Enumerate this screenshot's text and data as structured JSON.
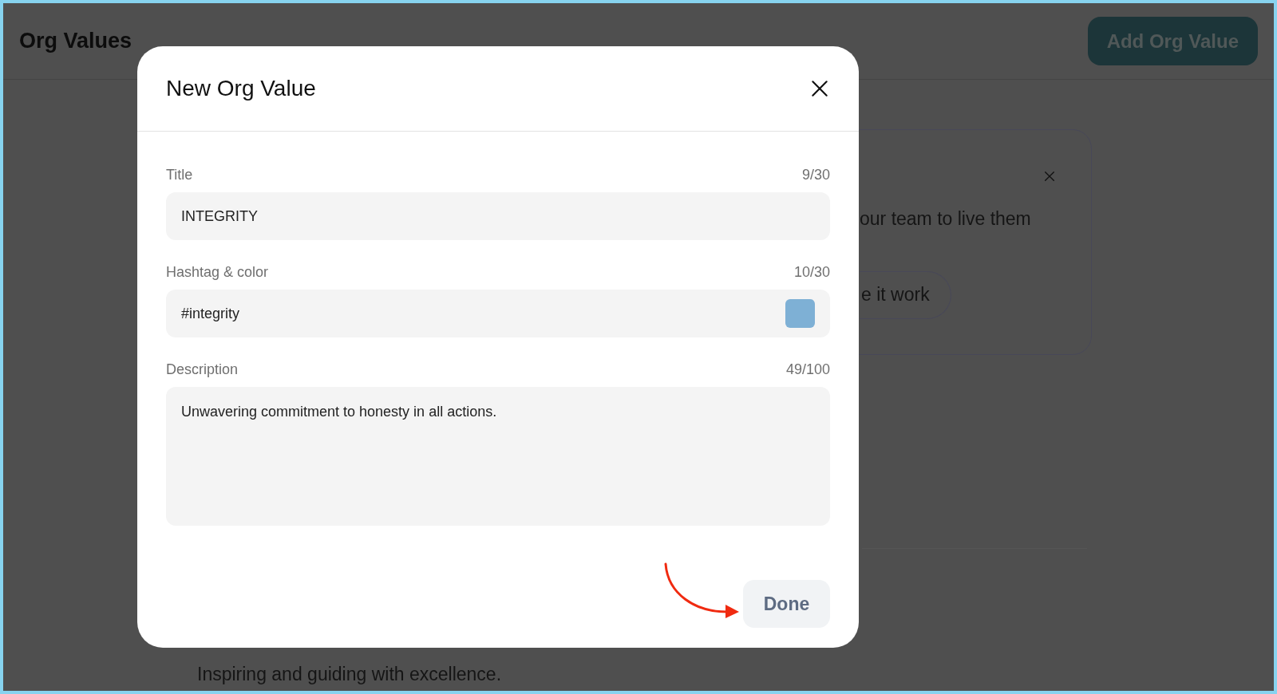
{
  "page": {
    "title": "Org Values",
    "add_button": "Add Org Value"
  },
  "background_card": {
    "text": "our team to live them",
    "button": "e it work"
  },
  "background_text": "Inspiring and guiding with excellence.",
  "dialog": {
    "title": "New Org Value",
    "fields": [
      {
        "kind": "text",
        "label": "Title",
        "count": "9/30",
        "value": "INTEGRITY"
      },
      {
        "kind": "color",
        "label": "Hashtag & color",
        "count": "10/30",
        "value": "#integrity",
        "color": "#7eb0d5"
      },
      {
        "kind": "textarea",
        "label": "Description",
        "count": "49/100",
        "value": "Unwavering commitment to honesty in all actions."
      }
    ],
    "done_button": "Done"
  }
}
